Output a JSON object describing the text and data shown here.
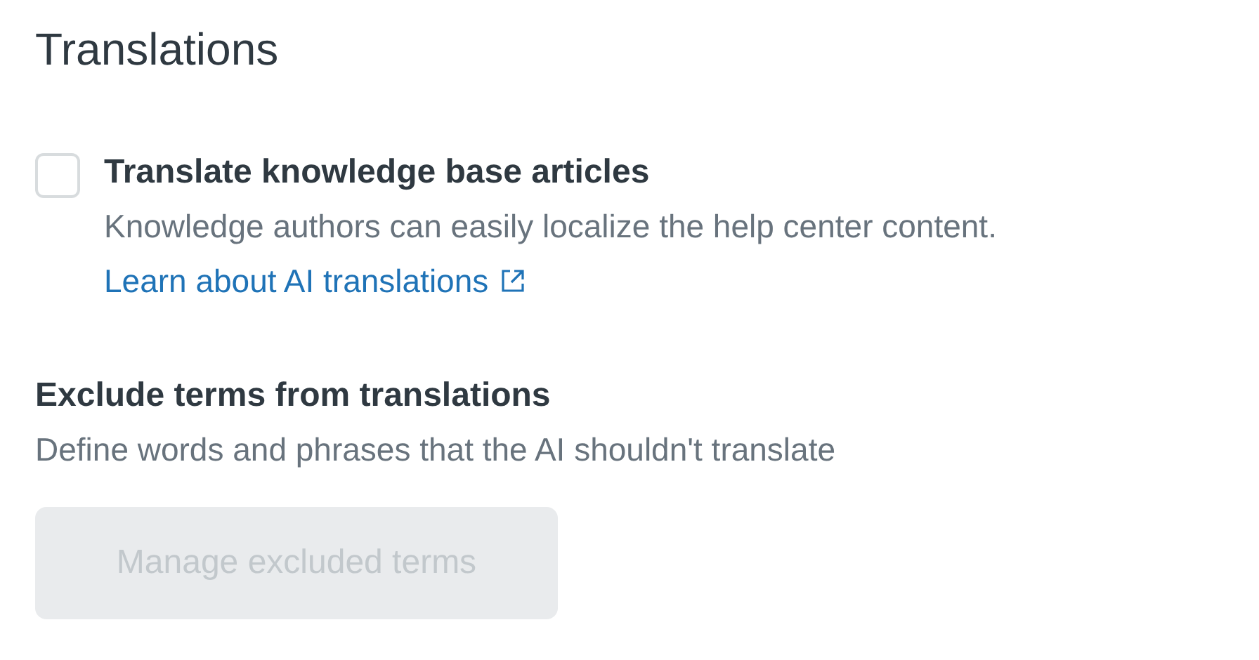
{
  "title": "Translations",
  "translate_option": {
    "label": "Translate knowledge base articles",
    "checked": false,
    "description": "Knowledge authors can easily localize the help center content.",
    "link": "Learn about AI translations"
  },
  "exclude_section": {
    "heading": "Exclude terms from translations",
    "description": "Define words and phrases that the AI shouldn't translate",
    "button": {
      "label": "Manage excluded terms",
      "disabled": true
    }
  }
}
